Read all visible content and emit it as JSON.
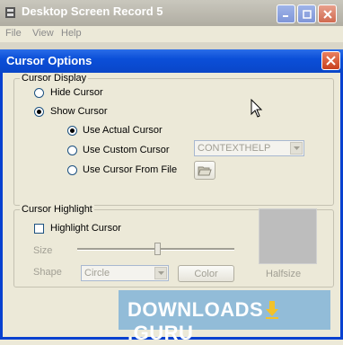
{
  "app": {
    "title": "Desktop Screen Record 5",
    "menu": [
      "File",
      "View",
      "Help"
    ]
  },
  "dialog": {
    "title": "Cursor Options",
    "cursor_display": {
      "label": "Cursor Display",
      "hide_label": "Hide Cursor",
      "show_label": "Show Cursor",
      "selected": "Show Cursor",
      "use_actual_label": "Use Actual Cursor",
      "use_custom_label": "Use Custom Cursor",
      "use_file_label": "Use Cursor From File",
      "cursor_type_selected": "Use Actual Cursor",
      "custom_cursor_value": "CONTEXTHELP"
    },
    "cursor_highlight": {
      "label": "Cursor Highlight",
      "highlight_label": "Highlight Cursor",
      "highlight_checked": false,
      "size_label": "Size",
      "shape_label": "Shape",
      "shape_value": "Circle",
      "color_button": "Color",
      "halfsize_label": "Halfsize",
      "swatch_color": "#bdbdbd"
    }
  },
  "watermark": {
    "text_left": "DOWNLOADS",
    "text_right": "GURU"
  },
  "colors": {
    "titlebar": "#0b4fd8",
    "dialog_bg": "#ece9d8",
    "disabled_text": "#a19f94"
  }
}
